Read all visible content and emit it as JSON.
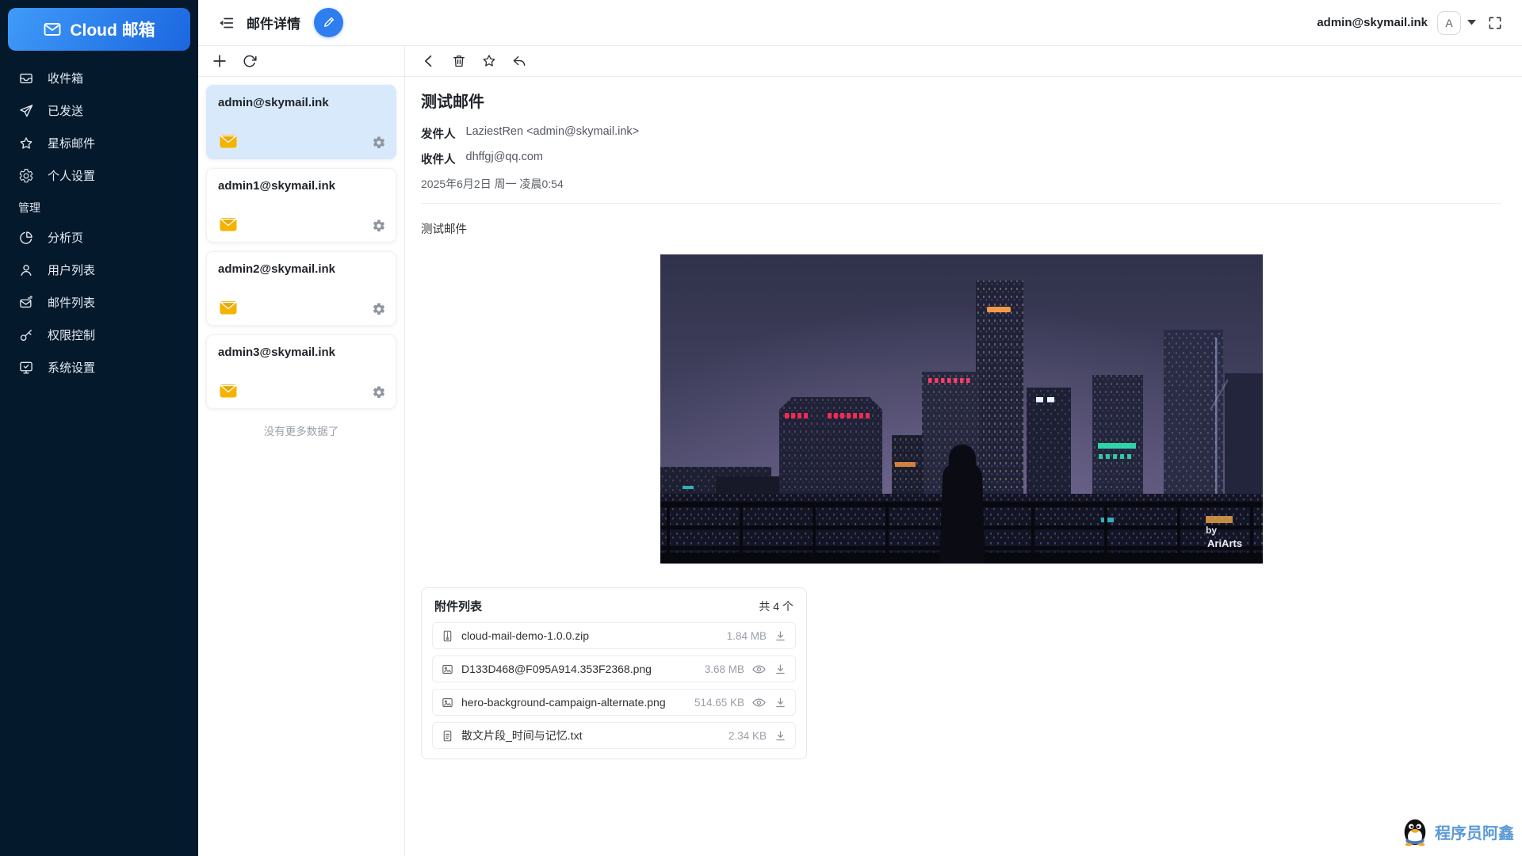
{
  "brand": {
    "name": "Cloud 邮箱"
  },
  "topbar": {
    "page_title": "邮件详情",
    "account": "admin@skymail.ink",
    "avatar_letter": "A"
  },
  "sidebar": {
    "items": [
      {
        "label": "收件箱",
        "icon": "inbox-icon"
      },
      {
        "label": "已发送",
        "icon": "send-icon"
      },
      {
        "label": "星标邮件",
        "icon": "star-icon"
      },
      {
        "label": "个人设置",
        "icon": "settings-gear-icon"
      }
    ],
    "section": "管理",
    "admin_items": [
      {
        "label": "分析页",
        "icon": "pie-chart-icon"
      },
      {
        "label": "用户列表",
        "icon": "user-icon"
      },
      {
        "label": "邮件列表",
        "icon": "mail-list-icon"
      },
      {
        "label": "权限控制",
        "icon": "key-icon"
      },
      {
        "label": "系统设置",
        "icon": "monitor-check-icon"
      }
    ]
  },
  "account_list": {
    "cards": [
      {
        "email": "admin@skymail.ink",
        "selected": true
      },
      {
        "email": "admin1@skymail.ink",
        "selected": false
      },
      {
        "email": "admin2@skymail.ink",
        "selected": false
      },
      {
        "email": "admin3@skymail.ink",
        "selected": false
      }
    ],
    "no_more_text": "没有更多数据了"
  },
  "mail": {
    "subject": "测试邮件",
    "from_label": "发件人",
    "from_value": "LaziestRen <admin@skymail.ink>",
    "to_label": "收件人",
    "to_value": "dhffgj@qq.com",
    "date": "2025年6月2日 周一 凌晨0:54",
    "body_text": "测试邮件",
    "image_credit_by": "by",
    "image_credit_artist": "AriArts"
  },
  "attachments": {
    "title": "附件列表",
    "count_text": "共 4 个",
    "items": [
      {
        "name": "cloud-mail-demo-1.0.0.zip",
        "size": "1.84 MB",
        "type": "zip",
        "preview": false
      },
      {
        "name": "D133D468@F095A914.353F2368.png",
        "size": "3.68 MB",
        "type": "image",
        "preview": true
      },
      {
        "name": "hero-background-campaign-alternate.png",
        "size": "514.65 KB",
        "type": "image",
        "preview": true
      },
      {
        "name": "散文片段_时间与记忆.txt",
        "size": "2.34 KB",
        "type": "text",
        "preview": false
      }
    ]
  },
  "footer": {
    "badge_text": "程序员阿鑫"
  },
  "icons": {
    "fold-icon": "≡",
    "compose-icon": "✎",
    "caret-down-icon": "▾",
    "fullscreen-icon": "⛶",
    "plus-icon": "+",
    "refresh-icon": "↻",
    "back-icon": "‹",
    "trash-icon": "🗑",
    "star-icon": "☆",
    "reply-icon": "↩",
    "envelope-icon": "✉",
    "gear-icon": "⚙",
    "eye-icon": "👁",
    "download-icon": "⤓",
    "zip-file-icon": "🗜",
    "image-file-icon": "🖼",
    "text-file-icon": "📄",
    "qq-penguin-logo": "🐧"
  },
  "colors": {
    "accent_blue": "#2f7ef0",
    "sidebar_bg": "#05192c",
    "selected_card_bg": "#d7e9fb",
    "envelope_yellow": "#f5b300",
    "neon_red": "#ff2a55",
    "neon_teal": "#35e3b2",
    "badge_blue": "#5a9ad5"
  }
}
